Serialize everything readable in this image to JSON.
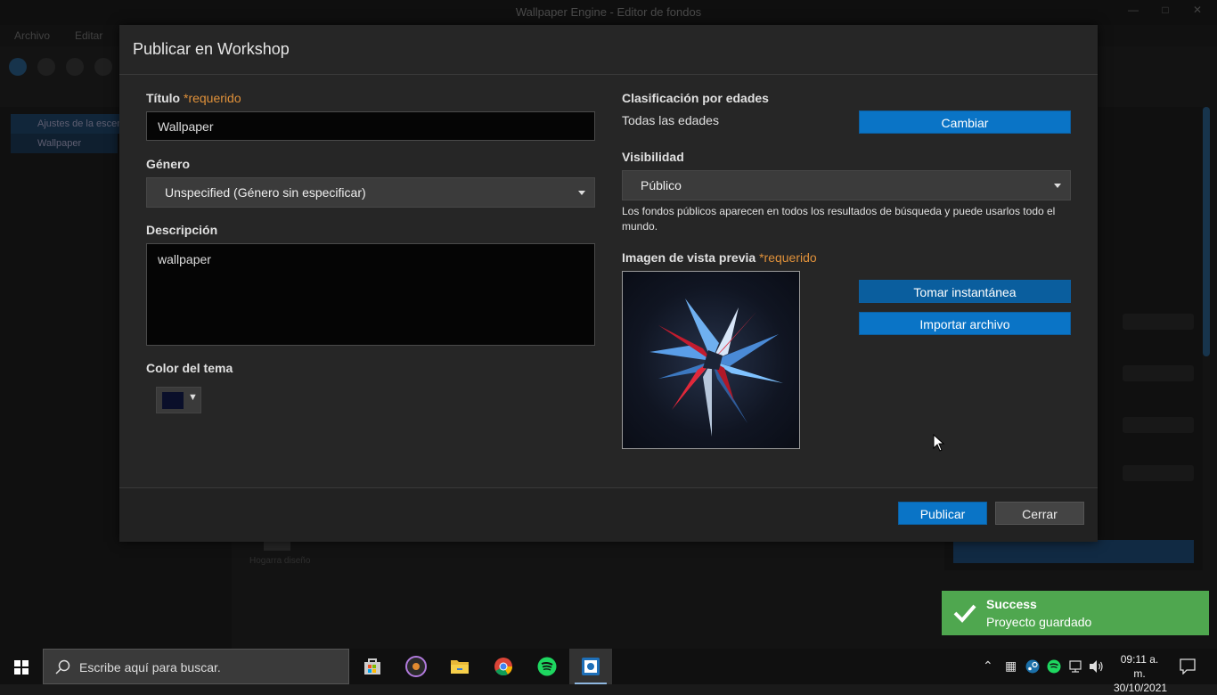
{
  "background_app": {
    "title": "Wallpaper Engine - Editor de fondos",
    "menu": [
      "Archivo",
      "Editar"
    ],
    "tree_items": [
      "Ajustes de la escena",
      "Wallpaper"
    ],
    "thumb_label": "Hogarra diseño"
  },
  "dialog": {
    "title": "Publicar en Workshop",
    "required_suffix": "*requerido",
    "title_field": {
      "label": "Título",
      "value": "Wallpaper"
    },
    "genre": {
      "label": "Género",
      "value": "Unspecified (Género sin especificar)"
    },
    "description": {
      "label": "Descripción",
      "value": "wallpaper"
    },
    "theme_color": {
      "label": "Color del tema",
      "value": "#0a0f2a"
    },
    "age_rating": {
      "label": "Clasificación por edades",
      "value": "Todas las edades",
      "change_button": "Cambiar"
    },
    "visibility": {
      "label": "Visibilidad",
      "value": "Público",
      "hint": "Los fondos públicos aparecen en todos los resultados de búsqueda y puede usarlos todo el mundo."
    },
    "preview": {
      "label": "Imagen de vista previa",
      "snapshot_button": "Tomar instantánea",
      "import_button": "Importar archivo"
    },
    "publish_button": "Publicar",
    "close_button": "Cerrar"
  },
  "toast": {
    "title": "Success",
    "message": "Proyecto guardado",
    "color": "#4fa74f"
  },
  "taskbar": {
    "search_placeholder": "Escribe aquí para buscar.",
    "apps": [
      "store-icon",
      "media-player-icon",
      "file-explorer-icon",
      "chrome-icon",
      "spotify-icon",
      "wallpaper-engine-icon"
    ],
    "clock_time": "09:11 a. m.",
    "clock_date": "30/10/2021"
  }
}
